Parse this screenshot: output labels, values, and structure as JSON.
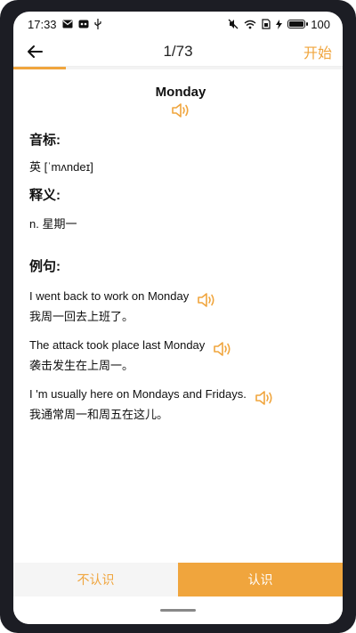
{
  "status_bar": {
    "time": "17:33",
    "battery": "100"
  },
  "header": {
    "counter": "1/73",
    "start_label": "开始",
    "progress": 0.16
  },
  "word": {
    "title": "Monday",
    "phonetic_title": "音标:",
    "phonetic": "英 [ˈmʌndeɪ]",
    "meaning_title": "释义:",
    "meaning": "n.  星期一"
  },
  "examples_title": "例句:",
  "examples": [
    {
      "en": "I went back to work on Monday",
      "zh": "我周一回去上班了。"
    },
    {
      "en": "The attack took place last Monday",
      "zh": "袭击发生在上周一。"
    },
    {
      "en": "I 'm usually here on Mondays and Fridays.",
      "zh": "我通常周一和周五在这儿。"
    }
  ],
  "buttons": {
    "unknown": "不认识",
    "known": "认识"
  },
  "colors": {
    "accent": "#f0a53d"
  }
}
